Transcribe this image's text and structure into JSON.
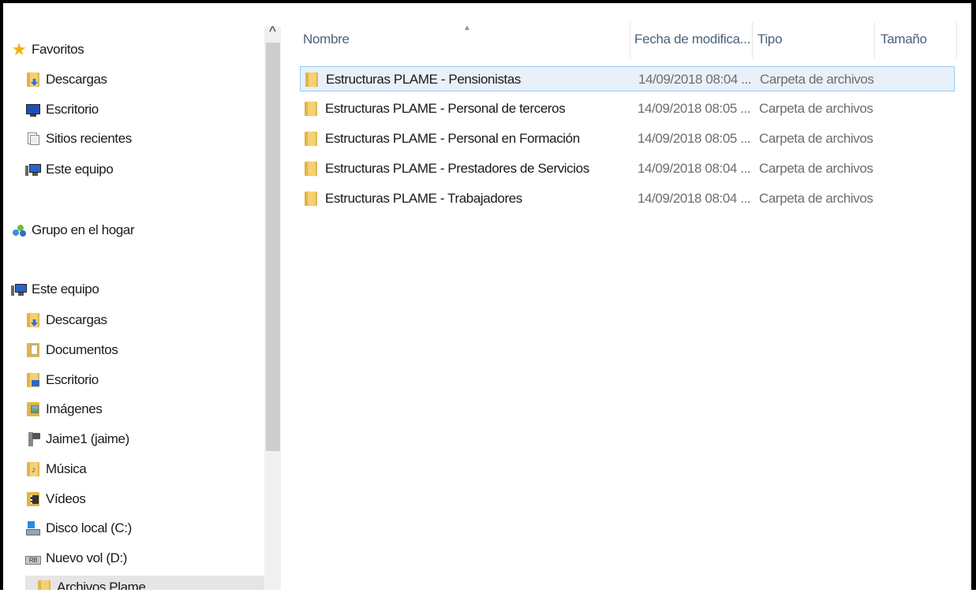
{
  "navigation": {
    "favorites": {
      "label": "Favoritos",
      "items": [
        {
          "label": "Descargas",
          "icon": "downloads-folder-icon"
        },
        {
          "label": "Escritorio",
          "icon": "desktop-icon"
        },
        {
          "label": "Sitios recientes",
          "icon": "recent-places-icon"
        },
        {
          "label": "Este equipo",
          "icon": "computer-icon"
        }
      ]
    },
    "homegroup": {
      "label": "Grupo en el hogar"
    },
    "this_pc": {
      "label": "Este equipo",
      "items": [
        {
          "label": "Descargas",
          "icon": "downloads-folder-icon"
        },
        {
          "label": "Documentos",
          "icon": "documents-folder-icon"
        },
        {
          "label": "Escritorio",
          "icon": "desktop-folder-icon"
        },
        {
          "label": "Imágenes",
          "icon": "pictures-folder-icon"
        },
        {
          "label": "Jaime1 (jaime)",
          "icon": "network-drive-icon"
        },
        {
          "label": "Música",
          "icon": "music-folder-icon"
        },
        {
          "label": "Vídeos",
          "icon": "videos-folder-icon"
        },
        {
          "label": "Disco local (C:)",
          "icon": "local-disk-icon"
        },
        {
          "label": "Nuevo vol (D:)",
          "icon": "volume-drive-icon"
        },
        {
          "label": "Archivos Plame",
          "icon": "folder-icon",
          "selected": true
        }
      ]
    }
  },
  "columns": {
    "name": "Nombre",
    "modified": "Fecha de modifica...",
    "type": "Tipo",
    "size": "Tamaño"
  },
  "files": [
    {
      "name": "Estructuras PLAME - Pensionistas",
      "modified": "14/09/2018 08:04 ...",
      "type": "Carpeta de archivos",
      "selected": true
    },
    {
      "name": "Estructuras PLAME - Personal de terceros",
      "modified": "14/09/2018 08:05 ...",
      "type": "Carpeta de archivos"
    },
    {
      "name": "Estructuras PLAME - Personal en Formación",
      "modified": "14/09/2018 08:05 ...",
      "type": "Carpeta de archivos"
    },
    {
      "name": "Estructuras PLAME - Prestadores de Servicios",
      "modified": "14/09/2018 08:04 ...",
      "type": "Carpeta de archivos"
    },
    {
      "name": "Estructuras PLAME - Trabajadores",
      "modified": "14/09/2018 08:04 ...",
      "type": "Carpeta de archivos"
    }
  ],
  "colors": {
    "selection_bg": "#e8f1fa",
    "selection_border": "#99c9ef",
    "header_text": "#4c607a",
    "nav_selected_bg": "#e5e5e5"
  }
}
